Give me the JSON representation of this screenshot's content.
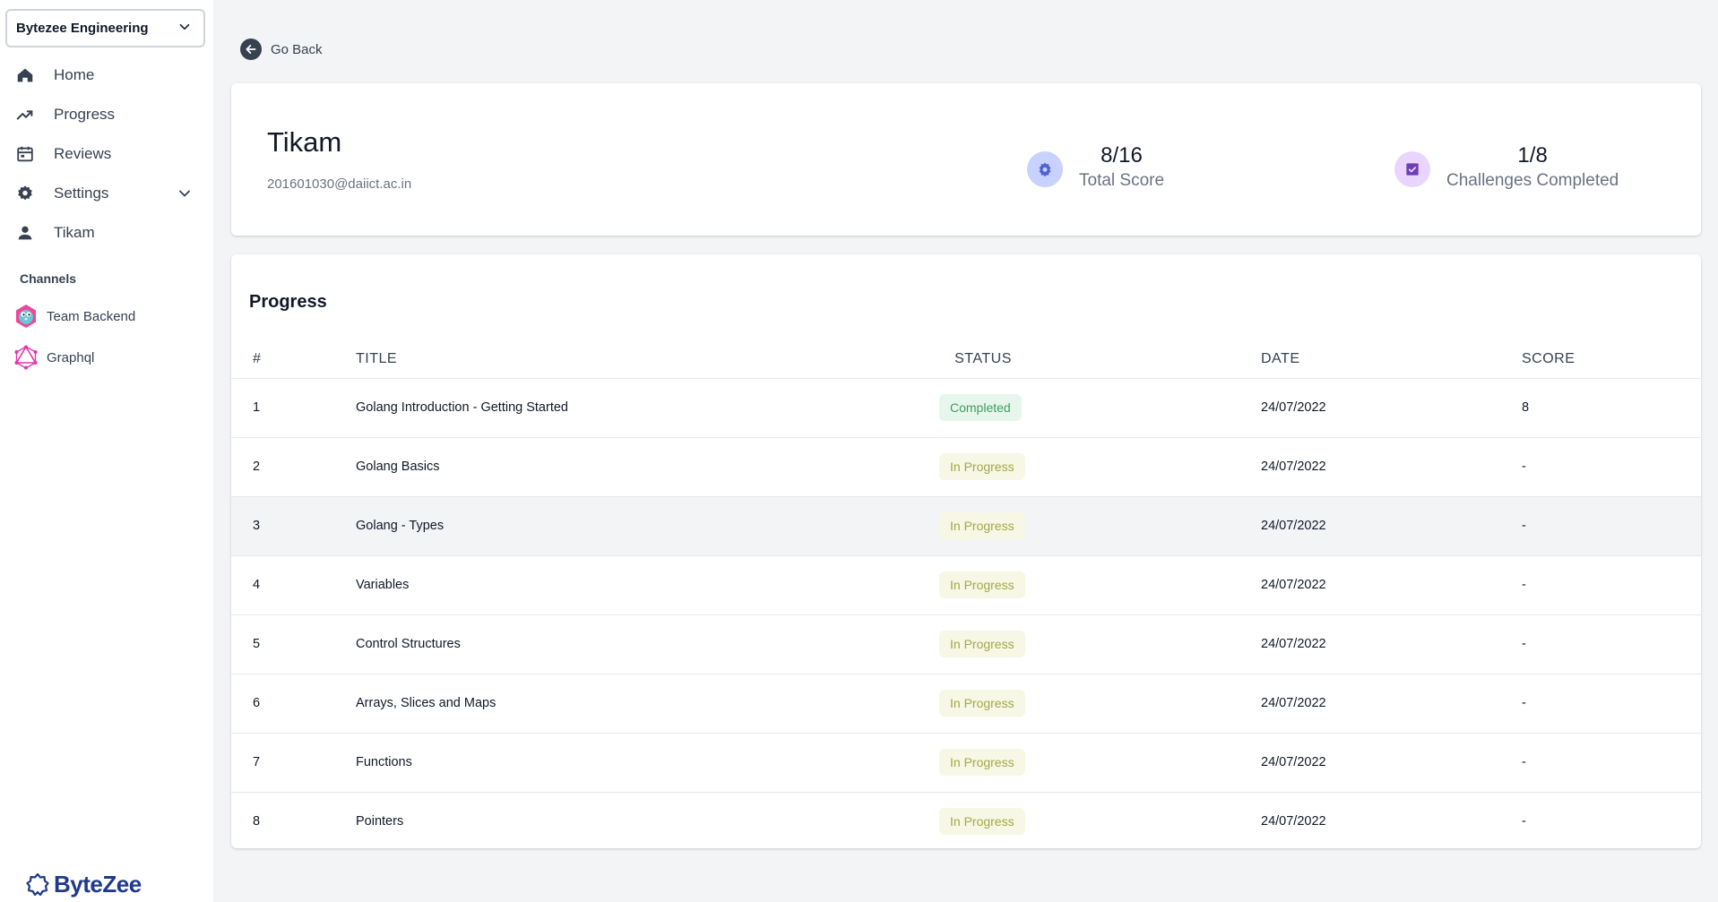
{
  "sidebar": {
    "org": "Bytezee Engineering",
    "nav": [
      {
        "label": "Home",
        "icon": "home-icon"
      },
      {
        "label": "Progress",
        "icon": "trending-up-icon"
      },
      {
        "label": "Reviews",
        "icon": "calendar-icon"
      },
      {
        "label": "Settings",
        "icon": "gear-icon"
      },
      {
        "label": "Tikam",
        "icon": "user-icon"
      }
    ],
    "channels_title": "Channels",
    "channels": [
      {
        "label": "Team Backend",
        "icon": "gopher-icon"
      },
      {
        "label": "Graphql",
        "icon": "graphql-icon"
      }
    ],
    "logo": "ByteZee"
  },
  "main": {
    "back_label": "Go Back",
    "profile": {
      "name": "Tikam",
      "email": "201601030@daiict.ac.in",
      "stats": [
        {
          "value": "8/16",
          "label": "Total Score",
          "icon": "badge-icon",
          "color": "#c7d2fe",
          "icon_color": "#4f63d2"
        },
        {
          "value": "1/8",
          "label": "Challenges Completed",
          "icon": "check-square-icon",
          "color": "#e9d5ff",
          "icon_color": "#6d3fb4"
        }
      ]
    },
    "progress": {
      "title": "Progress",
      "columns": [
        "#",
        "TITLE",
        "STATUS",
        "DATE",
        "SCORE"
      ],
      "rows": [
        {
          "num": "1",
          "title": "Golang Introduction - Getting Started",
          "status": "Completed",
          "date": "24/07/2022",
          "score": "8"
        },
        {
          "num": "2",
          "title": "Golang Basics",
          "status": "In Progress",
          "date": "24/07/2022",
          "score": "-"
        },
        {
          "num": "3",
          "title": "Golang - Types",
          "status": "In Progress",
          "date": "24/07/2022",
          "score": "-"
        },
        {
          "num": "4",
          "title": "Variables",
          "status": "In Progress",
          "date": "24/07/2022",
          "score": "-"
        },
        {
          "num": "5",
          "title": "Control Structures",
          "status": "In Progress",
          "date": "24/07/2022",
          "score": "-"
        },
        {
          "num": "6",
          "title": "Arrays, Slices and Maps",
          "status": "In Progress",
          "date": "24/07/2022",
          "score": "-"
        },
        {
          "num": "7",
          "title": "Functions",
          "status": "In Progress",
          "date": "24/07/2022",
          "score": "-"
        },
        {
          "num": "8",
          "title": "Pointers",
          "status": "In Progress",
          "date": "24/07/2022",
          "score": "-"
        }
      ]
    }
  }
}
